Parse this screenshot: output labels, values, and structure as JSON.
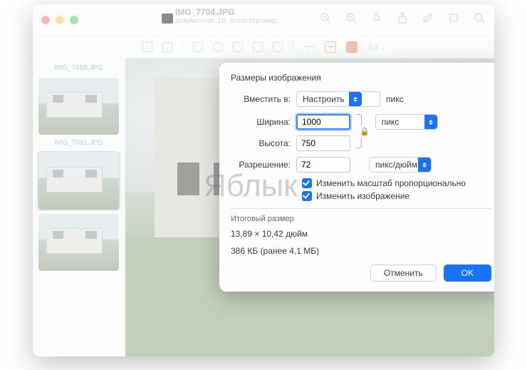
{
  "titlebar": {
    "filename": "IMG_7704.JPG",
    "subtitle": "документов: 18, всего страниц:..."
  },
  "sidebar": {
    "thumbs": [
      {
        "label": "IMG_7658.JPG"
      },
      {
        "label": "IMG_7691.JPG"
      },
      {
        "label": ""
      }
    ]
  },
  "watermark": "Яблык",
  "dialog": {
    "title": "Размеры изображения",
    "fit_label": "Вместить в:",
    "fit_value": "Настроить",
    "fit_unit": "пикс",
    "width_label": "Ширина:",
    "width_value": "1000",
    "height_label": "Высота:",
    "height_value": "750",
    "dim_unit": "пикс",
    "resolution_label": "Разрешение:",
    "resolution_value": "72",
    "resolution_unit": "пикс/дюйм",
    "scale_proportional": "Изменить масштаб пропорционально",
    "resample": "Изменить изображение",
    "result_section": "Итоговый размер",
    "result_dims": "13,89 × 10,42 дюйм",
    "result_size": "386 КБ (ранее 4,1 МБ)",
    "cancel": "Отменить",
    "ok": "OK"
  },
  "toolbar2": {
    "aa": "Aa"
  }
}
